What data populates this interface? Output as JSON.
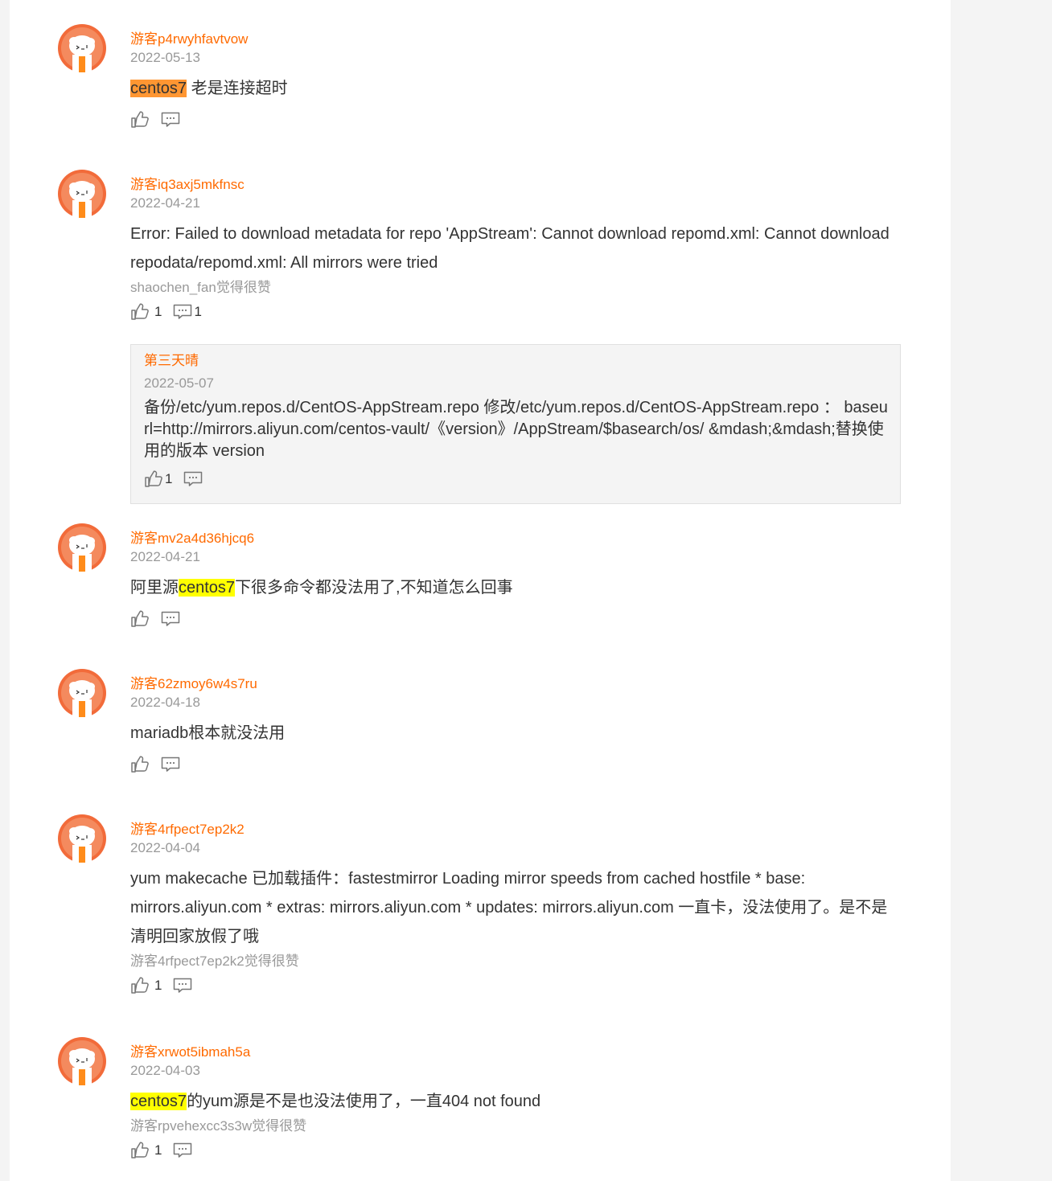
{
  "colors": {
    "username": "#ff6a00",
    "date": "#999999",
    "highlight_orange": "#ff9632",
    "highlight_yellow": "#ffff00",
    "reply_bg": "#f4f4f4"
  },
  "comments": [
    {
      "user": "游客p4rwyhfavtvow",
      "date": "2022-05-13",
      "text_hl": "centos7",
      "text_rest": " 老是连接超时",
      "likes": "",
      "replies": ""
    },
    {
      "user": "游客iq3axj5mkfnsc",
      "date": "2022-04-21",
      "text": "Error: Failed to download metadata for repo 'AppStream': Cannot download repomd.xml: Cannot download repodata/repomd.xml: All mirrors were tried",
      "liked_by": "shaochen_fan觉得很赞",
      "likes": "1",
      "replies": "1",
      "reply": {
        "user": "第三天晴",
        "date": "2022-05-07",
        "text": "备份/etc/yum.repos.d/CentOS-AppStream.repo 修改/etc/yum.repos.d/CentOS-AppStream.repo ： baseurl=http://mirrors.aliyun.com/centos-vault/《version》/AppStream/$basearch/os/ &mdash;&mdash;替换使用的版本 version",
        "likes": "1"
      }
    },
    {
      "user": "游客mv2a4d36hjcq6",
      "date": "2022-04-21",
      "text_pre": "阿里源",
      "text_hl": "centos7",
      "text_rest": "下很多命令都没法用了,不知道怎么回事"
    },
    {
      "user": "游客62zmoy6w4s7ru",
      "date": "2022-04-18",
      "text": "mariadb根本就没法用"
    },
    {
      "user": "游客4rfpect7ep2k2",
      "date": "2022-04-04",
      "text": "yum makecache 已加载插件：fastestmirror Loading mirror speeds from cached hostfile * base: mirrors.aliyun.com * extras: mirrors.aliyun.com * updates: mirrors.aliyun.com 一直卡，没法使用了。是不是清明回家放假了哦",
      "liked_by": "游客4rfpect7ep2k2觉得很赞",
      "likes": "1"
    },
    {
      "user": "游客xrwot5ibmah5a",
      "date": "2022-04-03",
      "text_hl": "centos7",
      "text_rest": "的yum源是不是也没法使用了，一直404 not found",
      "liked_by": "游客rpvehexcc3s3w觉得很赞",
      "likes": "1"
    }
  ]
}
